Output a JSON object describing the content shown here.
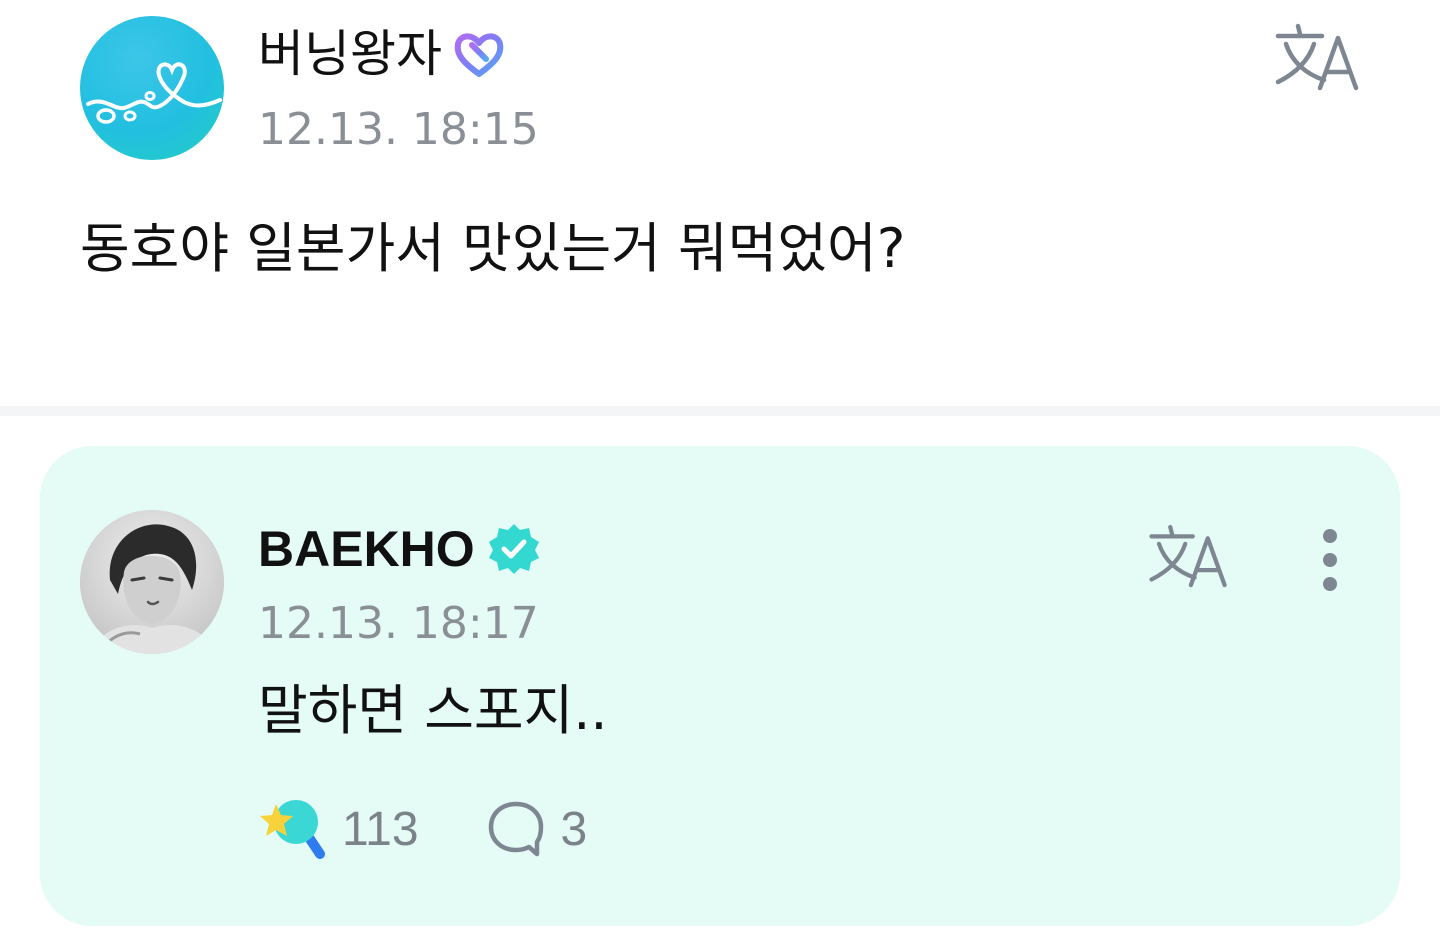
{
  "post": {
    "author": "버닝왕자",
    "author_badge_icon": "purple-heart-badge-icon",
    "timestamp": "12.13. 18:15",
    "body": "동호야 일본가서 맛있는거 뭐먹었어?",
    "translate_icon": "translate-icon"
  },
  "reply": {
    "author": "BAEKHO",
    "verified_icon": "verified-badge-icon",
    "timestamp": "12.13. 18:17",
    "body": "말하면 스포지..",
    "translate_icon": "translate-icon",
    "more_icon": "more-vertical-icon",
    "likes": "113",
    "comments": "3"
  },
  "colors": {
    "accent": "#33D8D0",
    "card_bg": "#E5FBF6",
    "muted_text": "#8A8F96",
    "icon_gray": "#7E8791"
  }
}
